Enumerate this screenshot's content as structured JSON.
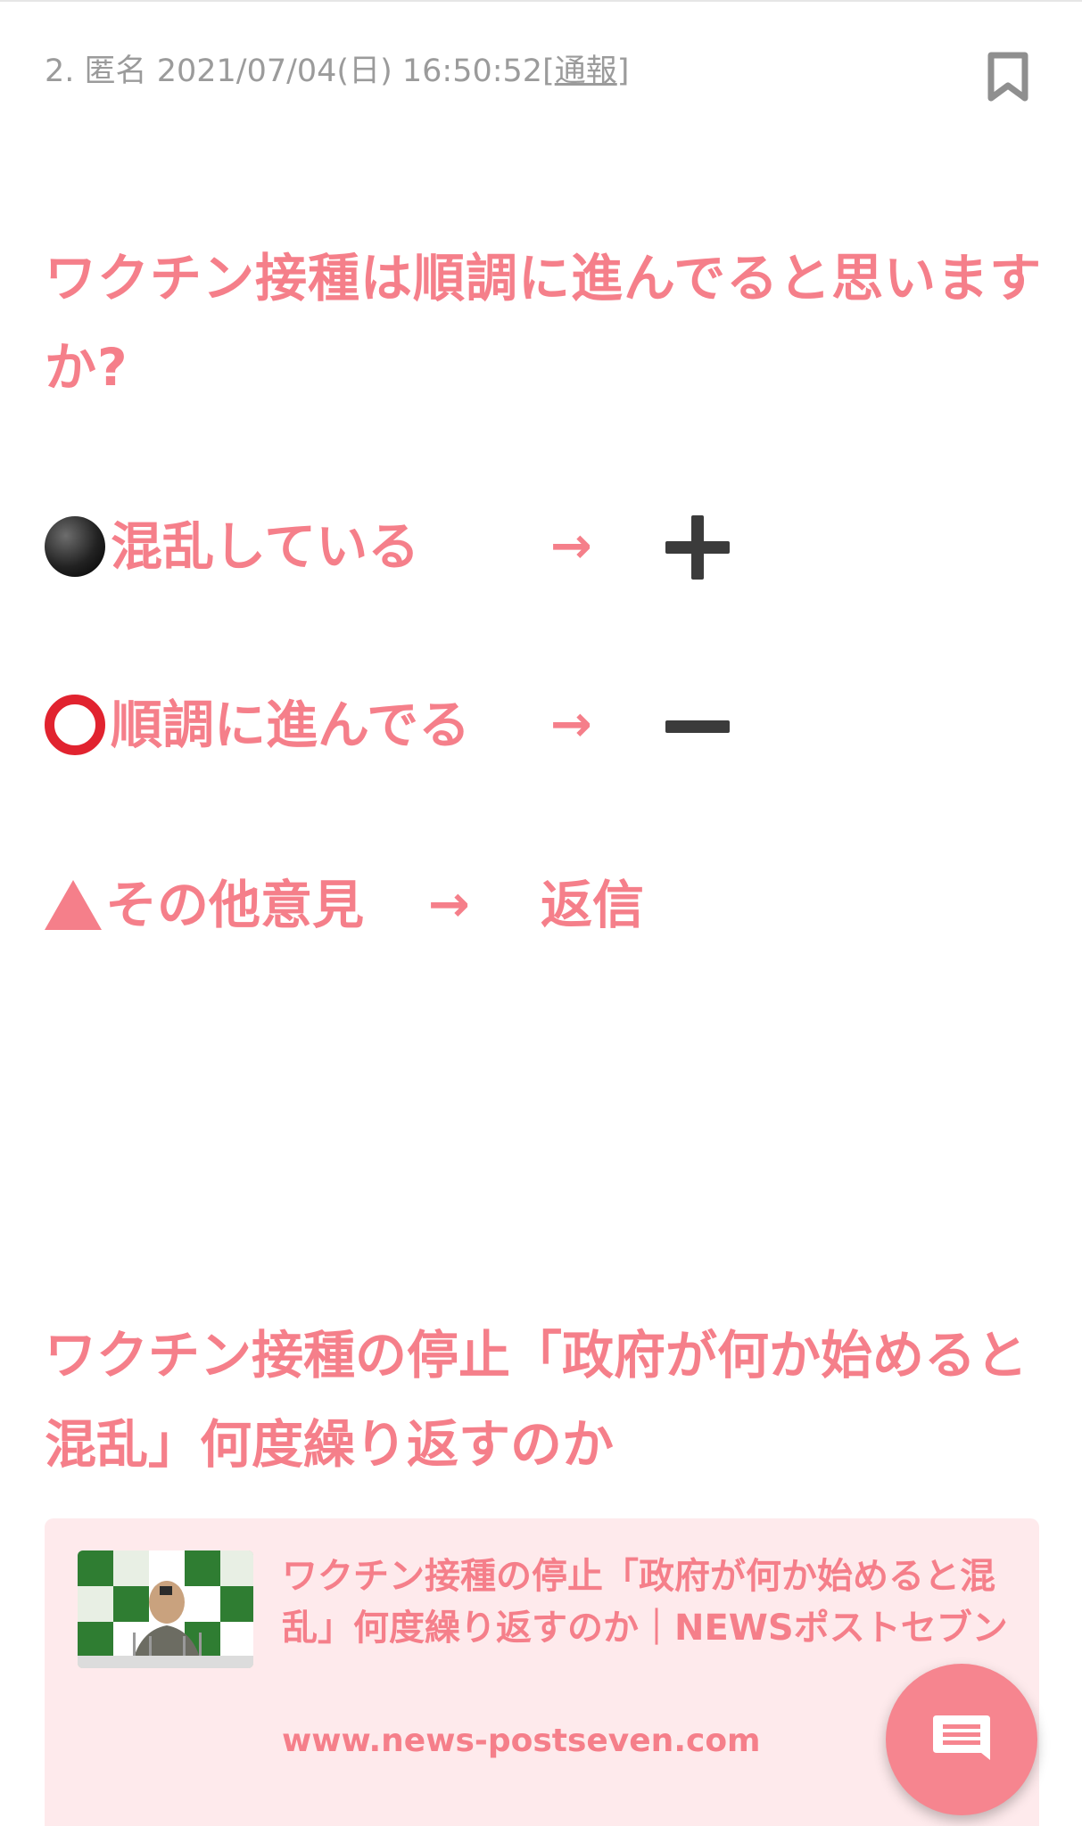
{
  "post": {
    "number": "2.",
    "author": "匿名",
    "datetime": "2021/07/04(日) 16:50:52",
    "report_open": "[",
    "report_label": "通報",
    "report_close": "]"
  },
  "question": "ワクチン接種は順調に進んでると思いますか?",
  "options": [
    {
      "label": "混乱している",
      "arrow": "→",
      "action": "plus"
    },
    {
      "label": "順調に進んでる",
      "arrow": "→",
      "action": "minus"
    },
    {
      "label": "その他意見",
      "arrow": "→",
      "action_label": "返信"
    }
  ],
  "headline": "ワクチン接種の停止「政府が何か始めると混乱」何度繰り返すのか",
  "link_card": {
    "title": "ワクチン接種の停止「政府が何か始めると混乱」何度繰り返すのか｜NEWSポストセブン",
    "url": "www.news-postseven.com"
  },
  "icons": {
    "bookmark": "bookmark-icon",
    "fab": "comment-icon"
  },
  "colors": {
    "accent": "#f57f8a",
    "card_bg": "#feeaec",
    "meta_text": "#9b9b9b",
    "fab": "#f6858f"
  }
}
